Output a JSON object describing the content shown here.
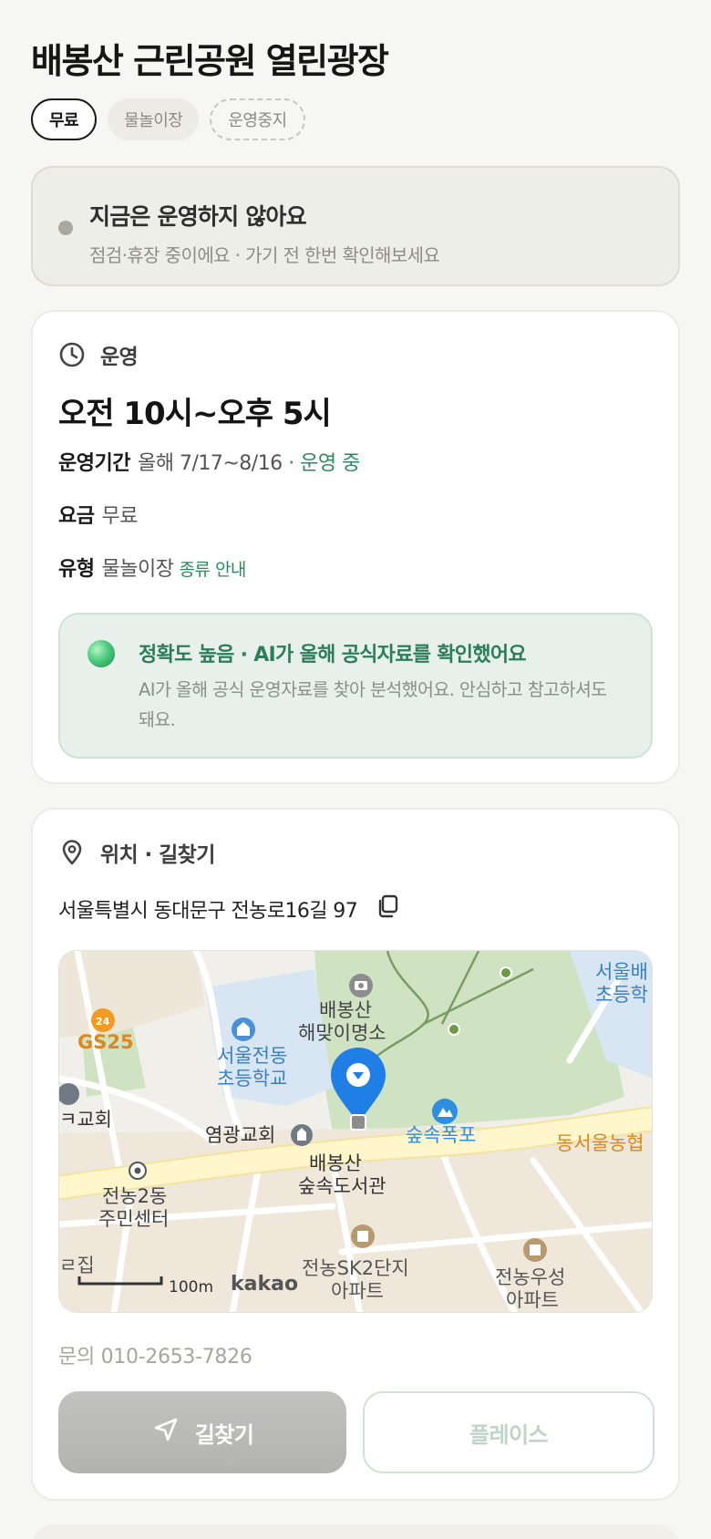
{
  "title": "배봉산 근린공원 열린광장",
  "chips": [
    "무료",
    "물놀이장",
    "운영중지"
  ],
  "notice": {
    "title": "지금은 운영하지 않아요",
    "subtitle": "점검·휴장 중이에요 · 가기 전 한번 확인해보세요"
  },
  "operation": {
    "section_label": "운영",
    "hours": "오전 10시~오후 5시",
    "period_label": "운영기간",
    "period_value": "올해 7/17~8/16",
    "period_status": "· 운영 중",
    "fee_label": "요금",
    "fee_value": "무료",
    "type_label": "유형",
    "type_value": "물놀이장",
    "type_link": "종류 안내"
  },
  "ai_confidence": {
    "title": "정확도 높음 · AI가 올해 공식자료를 확인했어요",
    "body": "AI가 올해 공식 운영자료를 찾아 분석했어요. 안심하고 참고하셔도 돼요."
  },
  "location": {
    "section_label": "위치 · 길찾기",
    "address": "서울특별시 동대문구 전농로16길 97",
    "contact": "문의 010-2653-7826"
  },
  "map": {
    "labels": {
      "gs25": "GS25",
      "school_1": "서울전동",
      "school_2": "초등학교",
      "viewpoint_1": "배봉산",
      "viewpoint_2": "해맞이명소",
      "church_left": "ㅋ교회",
      "church": "염광교회",
      "waterfall": "숲속폭포",
      "dongseoul": "동서울농협",
      "topright_1": "서울배",
      "topright_2": "초등학",
      "center_1": "전농2동",
      "center_2": "주민센터",
      "library_1": "배봉산",
      "library_2": "숲속도서관",
      "apt1_1": "전농SK2단지",
      "apt1_2": "아파트",
      "apt2_1": "전농우성",
      "apt2_2": "아파트",
      "edge_left": "ㄹ집",
      "scale": "100m",
      "provider": "kakao"
    },
    "colors": {
      "park": "#cfe3c3",
      "road": "#fff6cc",
      "water": "#d7e6f2",
      "marker": "#1f7fe6"
    }
  },
  "buttons": {
    "directions": "길찾기",
    "place": "플레이스"
  }
}
